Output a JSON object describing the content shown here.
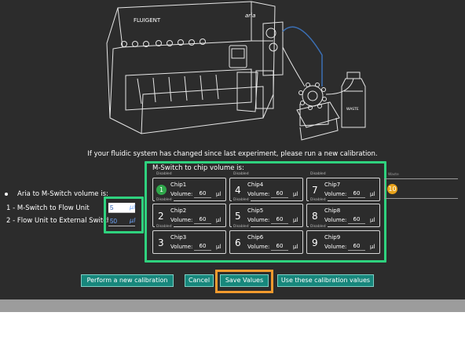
{
  "notice": "If your fluidic system has changed since last experiment, please run a new calibration.",
  "device": {
    "brand": "FLUIGENT",
    "model": "aria",
    "waste_label": "WASTE"
  },
  "left": {
    "aria_label": "Aria to M-Switch volume is:",
    "mswitch_flow_label": "1 - M-Switch to Flow Unit",
    "flow_switch_label": "2 - Flow Unit to External Switch",
    "mswitch_flow_value": "5",
    "flow_switch_value": "50",
    "unit": "µl"
  },
  "mswitch": {
    "title": "M-Switch to chip volume is:",
    "disabled_label": "Disabled",
    "volume_label": "Volume:",
    "unit": "µl",
    "chips": [
      {
        "num": "1",
        "name": "Chip1",
        "volume": "60"
      },
      {
        "num": "2",
        "name": "Chip2",
        "volume": "60"
      },
      {
        "num": "3",
        "name": "Chip3",
        "volume": "60"
      },
      {
        "num": "4",
        "name": "Chip4",
        "volume": "60"
      },
      {
        "num": "5",
        "name": "Chip5",
        "volume": "60"
      },
      {
        "num": "6",
        "name": "Chip6",
        "volume": "60"
      },
      {
        "num": "7",
        "name": "Chip7",
        "volume": "60"
      },
      {
        "num": "8",
        "name": "Chip8",
        "volume": "60"
      },
      {
        "num": "9",
        "name": "Chip9",
        "volume": "60"
      }
    ],
    "chip10": {
      "num": "10",
      "mode": "Waste"
    },
    "active_color": "#2fa84a",
    "chip10_color": "#e8a21a"
  },
  "buttons": {
    "calibration": "Perform a new calibration",
    "cancel": "Cancel",
    "save": "Save Values",
    "use_values": "Use these calibration values"
  },
  "highlight_colors": {
    "green": "#2fd27e",
    "orange": "#f29a2e",
    "button": "#17877c"
  }
}
